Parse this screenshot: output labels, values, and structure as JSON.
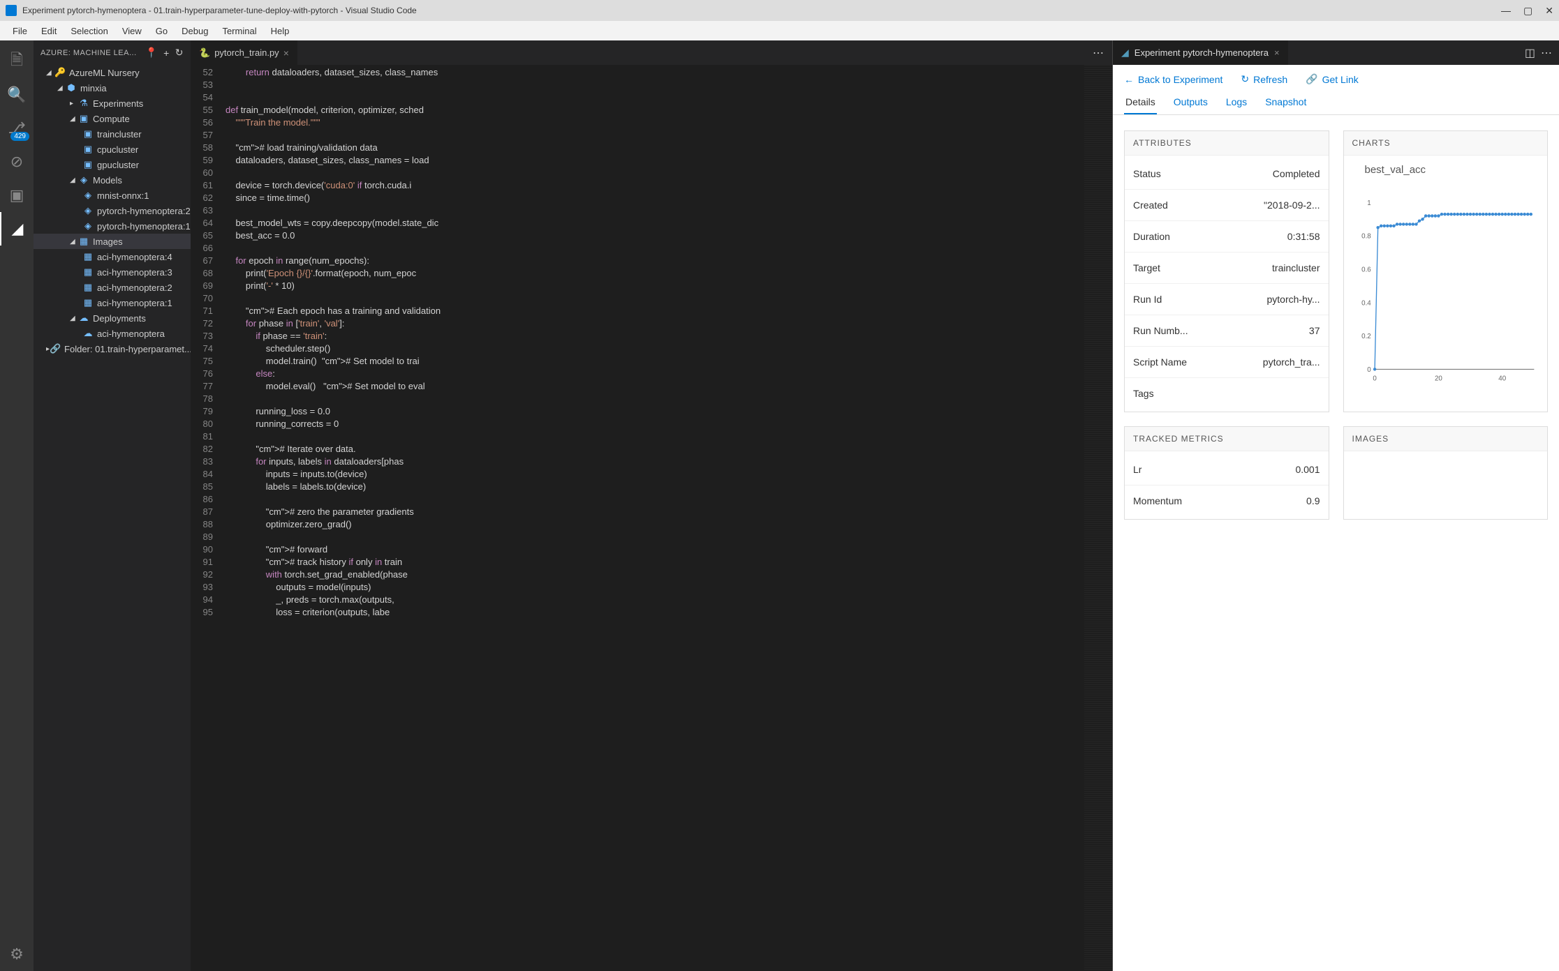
{
  "window": {
    "title": "Experiment pytorch-hymenoptera - 01.train-hyperparameter-tune-deploy-with-pytorch - Visual Studio Code"
  },
  "menu": [
    "File",
    "Edit",
    "Selection",
    "View",
    "Go",
    "Debug",
    "Terminal",
    "Help"
  ],
  "activity": {
    "scm_badge": "429"
  },
  "sidebar": {
    "title": "AZURE: MACHINE LEA...",
    "root": "AzureML Nursery",
    "ws": "minxia",
    "groups": {
      "experiments": "Experiments",
      "compute": "Compute",
      "models": "Models",
      "images": "Images",
      "deployments": "Deployments",
      "folder": "Folder: 01.train-hyperparamet..."
    },
    "compute": [
      "traincluster",
      "cpucluster",
      "gpucluster"
    ],
    "models": [
      "mnist-onnx:1",
      "pytorch-hymenoptera:2",
      "pytorch-hymenoptera:1"
    ],
    "images": [
      "aci-hymenoptera:4",
      "aci-hymenoptera:3",
      "aci-hymenoptera:2",
      "aci-hymenoptera:1"
    ],
    "deployments": [
      "aci-hymenoptera"
    ]
  },
  "editor": {
    "tab": "pytorch_train.py",
    "first_line": 52,
    "lines": [
      "        return dataloaders, dataset_sizes, class_names",
      "",
      "",
      "def train_model(model, criterion, optimizer, sched",
      "    \"\"\"Train the model.\"\"\"",
      "",
      "    # load training/validation data",
      "    dataloaders, dataset_sizes, class_names = load",
      "",
      "    device = torch.device('cuda:0' if torch.cuda.i",
      "    since = time.time()",
      "",
      "    best_model_wts = copy.deepcopy(model.state_dic",
      "    best_acc = 0.0",
      "",
      "    for epoch in range(num_epochs):",
      "        print('Epoch {}/{}'.format(epoch, num_epoc",
      "        print('-' * 10)",
      "",
      "        # Each epoch has a training and validation",
      "        for phase in ['train', 'val']:",
      "            if phase == 'train':",
      "                scheduler.step()",
      "                model.train()  # Set model to trai",
      "            else:",
      "                model.eval()   # Set model to eval",
      "",
      "            running_loss = 0.0",
      "            running_corrects = 0",
      "",
      "            # Iterate over data.",
      "            for inputs, labels in dataloaders[phas",
      "                inputs = inputs.to(device)",
      "                labels = labels.to(device)",
      "",
      "                # zero the parameter gradients",
      "                optimizer.zero_grad()",
      "",
      "                # forward",
      "                # track history if only in train",
      "                with torch.set_grad_enabled(phase ",
      "                    outputs = model(inputs)",
      "                    _, preds = torch.max(outputs, ",
      "                    loss = criterion(outputs, labe"
    ]
  },
  "experiment": {
    "tab_title": "Experiment pytorch-hymenoptera",
    "actions": {
      "back": "Back to Experiment",
      "refresh": "Refresh",
      "link": "Get Link"
    },
    "detail_tabs": [
      "Details",
      "Outputs",
      "Logs",
      "Snapshot"
    ],
    "attributes_title": "ATTRIBUTES",
    "attributes": [
      {
        "k": "Status",
        "v": "Completed"
      },
      {
        "k": "Created",
        "v": "\"2018-09-2..."
      },
      {
        "k": "Duration",
        "v": "0:31:58"
      },
      {
        "k": "Target",
        "v": "traincluster"
      },
      {
        "k": "Run Id",
        "v": "pytorch-hy..."
      },
      {
        "k": "Run Numb...",
        "v": "37"
      },
      {
        "k": "Script Name",
        "v": "pytorch_tra..."
      },
      {
        "k": "Tags",
        "v": ""
      }
    ],
    "charts_title": "CHARTS",
    "metrics_title": "TRACKED METRICS",
    "metrics": [
      {
        "k": "Lr",
        "v": "0.001"
      },
      {
        "k": "Momentum",
        "v": "0.9"
      }
    ],
    "images_title": "IMAGES"
  },
  "chart_data": {
    "type": "line",
    "title": "best_val_acc",
    "xlabel": "",
    "ylabel": "",
    "xlim": [
      0,
      50
    ],
    "ylim": [
      0,
      1
    ],
    "x_ticks": [
      0,
      20,
      40
    ],
    "y_ticks": [
      0,
      0.2,
      0.4,
      0.6,
      0.8,
      1
    ],
    "x": [
      0,
      1,
      2,
      3,
      4,
      5,
      6,
      7,
      8,
      9,
      10,
      11,
      12,
      13,
      14,
      15,
      16,
      17,
      18,
      19,
      20,
      21,
      22,
      23,
      24,
      25,
      26,
      27,
      28,
      29,
      30,
      31,
      32,
      33,
      34,
      35,
      36,
      37,
      38,
      39,
      40,
      41,
      42,
      43,
      44,
      45,
      46,
      47,
      48,
      49
    ],
    "values": [
      0.0,
      0.85,
      0.86,
      0.86,
      0.86,
      0.86,
      0.86,
      0.87,
      0.87,
      0.87,
      0.87,
      0.87,
      0.87,
      0.87,
      0.89,
      0.9,
      0.92,
      0.92,
      0.92,
      0.92,
      0.92,
      0.93,
      0.93,
      0.93,
      0.93,
      0.93,
      0.93,
      0.93,
      0.93,
      0.93,
      0.93,
      0.93,
      0.93,
      0.93,
      0.93,
      0.93,
      0.93,
      0.93,
      0.93,
      0.93,
      0.93,
      0.93,
      0.93,
      0.93,
      0.93,
      0.93,
      0.93,
      0.93,
      0.93,
      0.93
    ]
  }
}
